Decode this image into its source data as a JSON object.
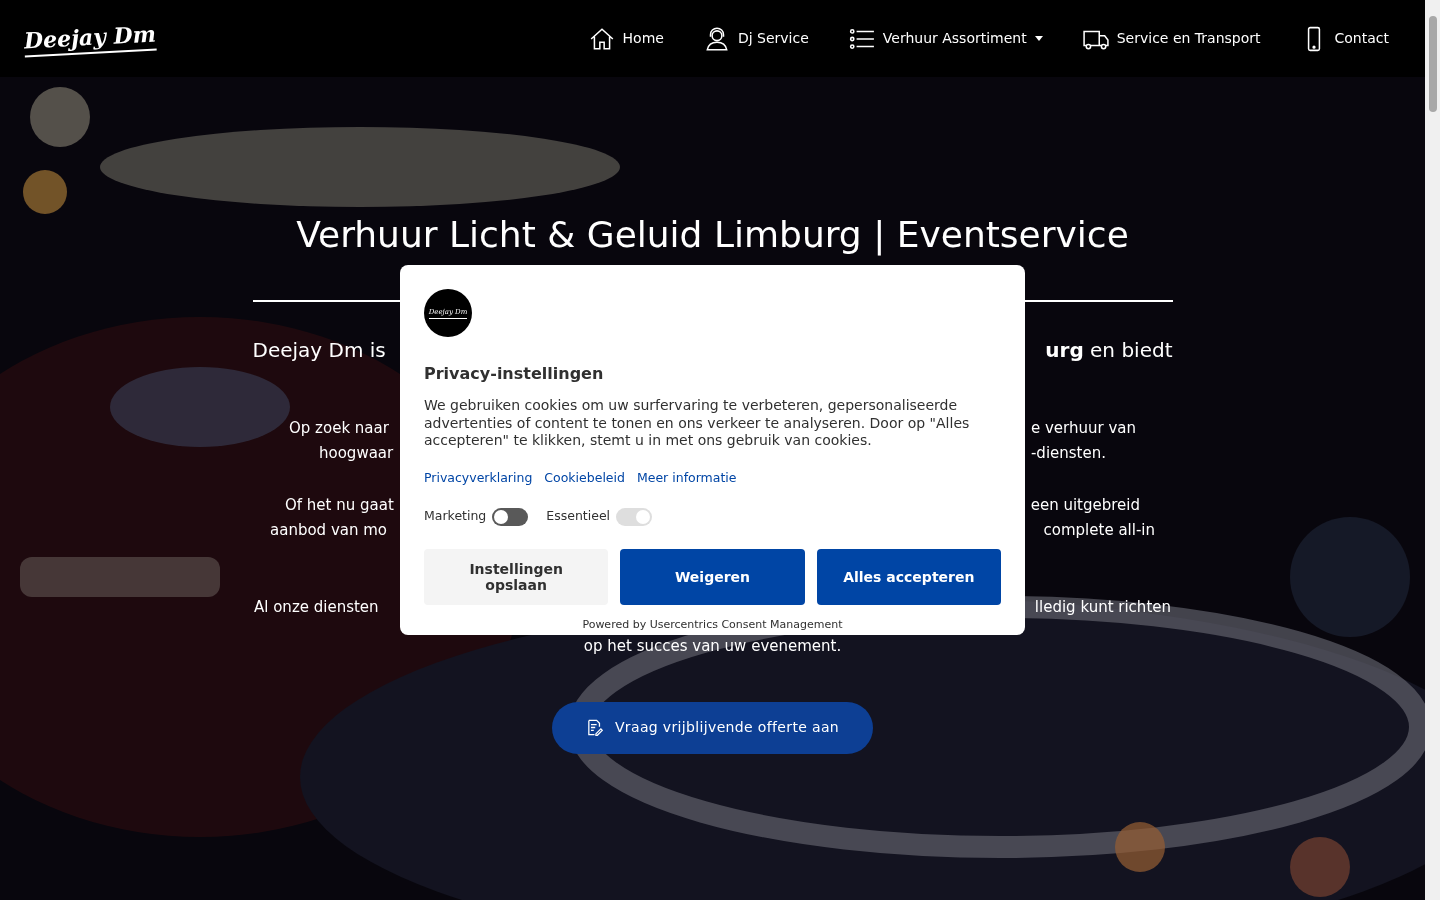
{
  "nav": {
    "logo": "Deejay Dm",
    "items": [
      {
        "label": "Home",
        "dropdown": false
      },
      {
        "label": "Dj Service",
        "dropdown": false
      },
      {
        "label": "Verhuur Assortiment",
        "dropdown": true
      },
      {
        "label": "Service en Transport",
        "dropdown": false
      },
      {
        "label": "Contact",
        "dropdown": false
      }
    ]
  },
  "hero": {
    "title": "Verhuur Licht & Geluid Limburg | Eventservice",
    "subtitle": {
      "left": "Deejay Dm is",
      "right": "**urg** en biedt"
    },
    "lines": [
      {
        "left": "Op zoek naar",
        "right": "e verhuur van"
      },
      {
        "left": "hoogwaar",
        "right": "-diensten."
      },
      {
        "left": "Of het nu gaat",
        "right": "een uitgebreid"
      },
      {
        "left": "aanbod van mo",
        "right": "complete all-in"
      },
      {
        "left": "Al onze diensten",
        "right": "lledig kunt richten"
      }
    ],
    "last_line": "op het succes van uw evenement.",
    "cta": "Vraag vrijblijvende offerte aan"
  },
  "consent": {
    "logo": "Deejay Dm",
    "title": "Privacy-instellingen",
    "text": "We gebruiken cookies om uw surfervaring te verbeteren, gepersonaliseerde advertenties of content te tonen en ons verkeer te analyseren. Door op \"Alles accepteren\" te klikken, stemt u in met ons gebruik van cookies.",
    "links": [
      "Privacyverklaring",
      "Cookiebeleid",
      "Meer informatie"
    ],
    "toggles": [
      {
        "label": "Marketing",
        "on": false,
        "disabled": false
      },
      {
        "label": "Essentieel",
        "on": true,
        "disabled": true
      }
    ],
    "buttons": [
      {
        "label": "Instellingen opslaan",
        "kind": "secondary"
      },
      {
        "label": "Weigeren",
        "kind": "primary"
      },
      {
        "label": "Alles accepteren",
        "kind": "primary"
      }
    ],
    "footer": "Powered by Usercentrics Consent Management"
  }
}
